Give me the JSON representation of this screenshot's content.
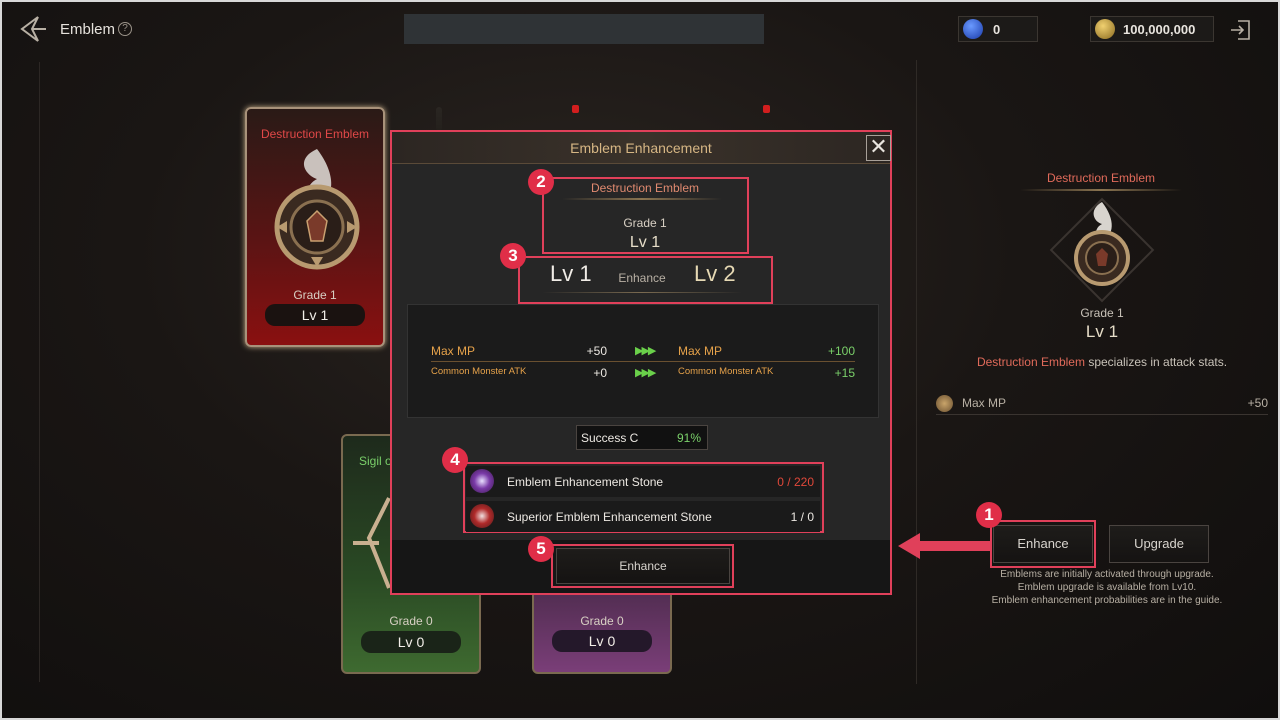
{
  "header": {
    "title": "Emblem",
    "help_icon": "?"
  },
  "resources": [
    {
      "icon": "gem-icon",
      "value": "0",
      "color": "#2a5ad8"
    },
    {
      "icon": "gold-coin-icon",
      "value": "100,000,000",
      "color": "#c9a040"
    }
  ],
  "cards": {
    "selected": {
      "name": "Destruction Emblem",
      "grade": "Grade 1",
      "level": "Lv 1"
    },
    "green": {
      "name": "Sigil o",
      "grade": "Grade 0",
      "level": "Lv 0"
    },
    "purple": {
      "grade": "Grade 0",
      "level": "Lv 0"
    }
  },
  "right_panel": {
    "name": "Destruction Emblem",
    "grade": "Grade 1",
    "level": "Lv 1",
    "desc_highlight": "Destruction Emblem",
    "desc_rest": " specializes in attack stats.",
    "stat_name": "Max MP",
    "stat_value": "+50",
    "enhance_label": "Enhance",
    "upgrade_label": "Upgrade",
    "notes": [
      "Emblems are initially activated through upgrade.",
      "Emblem upgrade is available from Lv10.",
      "Emblem enhancement probabilities are in the guide."
    ]
  },
  "modal": {
    "title": "Emblem Enhancement",
    "close": "✕",
    "emblem_name": "Destruction Emblem",
    "grade": "Grade 1",
    "level": "Lv 1",
    "from_level": "Lv 1",
    "enhance_mid": "Enhance",
    "to_level": "Lv 2",
    "stats": [
      {
        "name": "Max MP",
        "before": "+50",
        "after_name": "Max MP",
        "after": "+100"
      },
      {
        "name": "Common Monster ATK",
        "before": "+0",
        "after_name": "Common Monster ATK",
        "after": "+15"
      }
    ],
    "arrow_glyph": "▶▶▶",
    "success_label": "Success C",
    "success_value": "91%",
    "materials": [
      {
        "name": "Emblem Enhancement Stone",
        "count": "0 / 220",
        "count_color": "#e0483a",
        "icon": "enhancement-stone-icon"
      },
      {
        "name": "Superior Emblem Enhancement Stone",
        "count": "1 / 0",
        "count_color": "#ece8e2",
        "icon": "superior-stone-icon"
      }
    ],
    "enhance_button": "Enhance"
  },
  "badges": [
    "1",
    "2",
    "3",
    "4",
    "5"
  ]
}
